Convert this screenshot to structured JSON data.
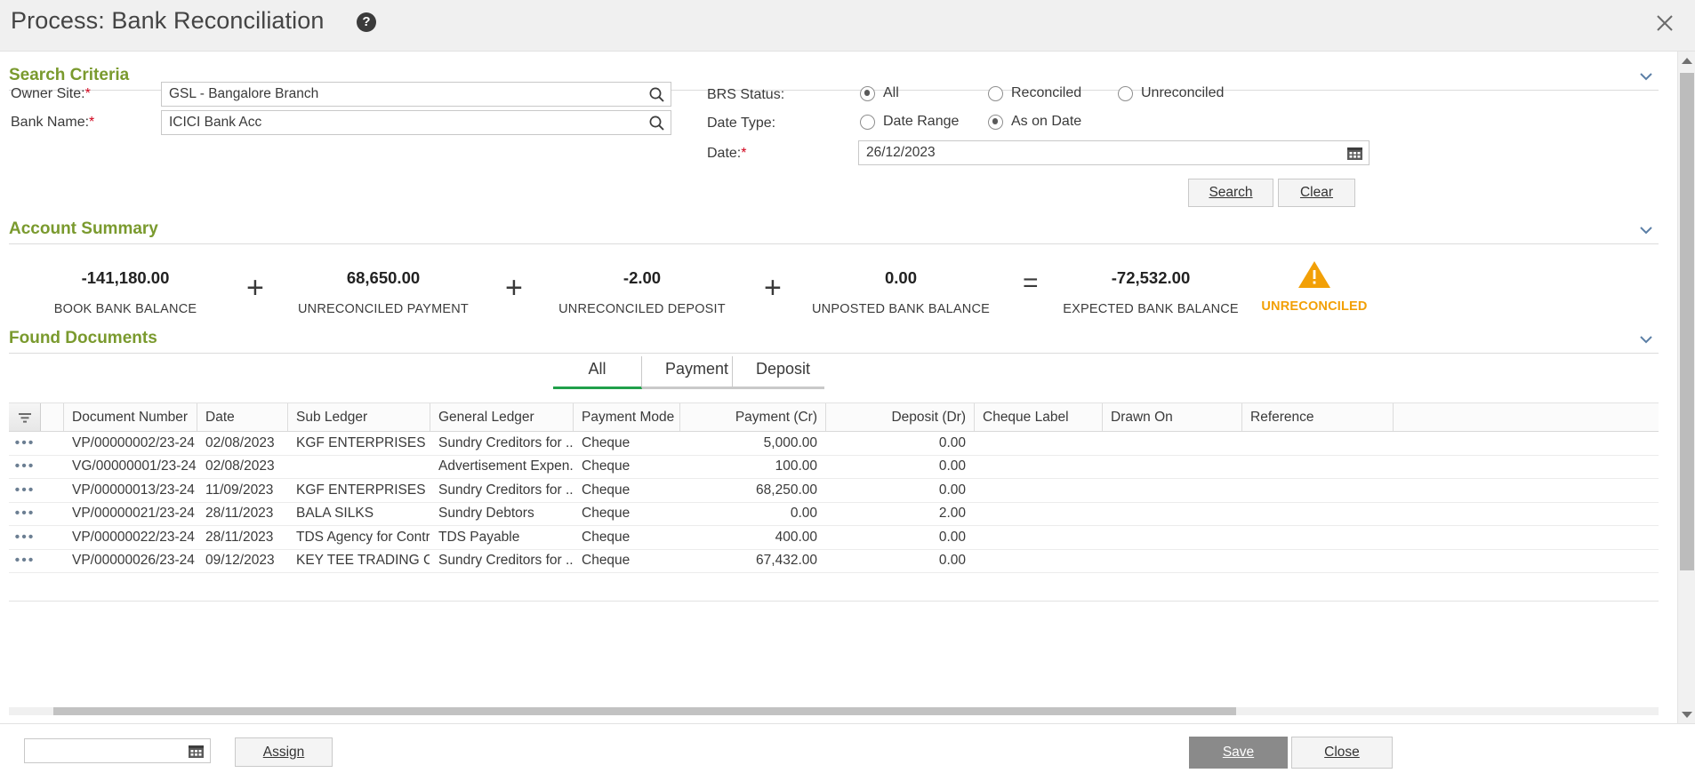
{
  "window": {
    "title": "Process: Bank Reconciliation",
    "help_icon": "help-icon",
    "close_icon": "close-icon"
  },
  "search_criteria": {
    "heading": "Search Criteria",
    "owner_site": {
      "label": "Owner Site:",
      "required": "*",
      "value": "GSL - Bangalore Branch",
      "placeholder": ""
    },
    "bank_name": {
      "label": "Bank Name:",
      "required": "*",
      "value": "ICICI Bank Acc",
      "placeholder": ""
    },
    "brs_status": {
      "label": "BRS Status:",
      "options": [
        "All",
        "Reconciled",
        "Unreconciled"
      ],
      "selected": "All"
    },
    "date_type": {
      "label": "Date Type:",
      "options": [
        "Date Range",
        "As on Date"
      ],
      "selected": "As on Date"
    },
    "date": {
      "label": "Date:",
      "required": "*",
      "value": "26/12/2023",
      "placeholder": ""
    },
    "search_button": "Search",
    "clear_button": "Clear"
  },
  "account_summary": {
    "heading": "Account Summary",
    "cells": [
      {
        "value": "-141,180.00",
        "label": "BOOK BANK BALANCE"
      },
      {
        "value": "68,650.00",
        "label": "UNRECONCILED PAYMENT"
      },
      {
        "value": "-2.00",
        "label": "UNRECONCILED DEPOSIT"
      },
      {
        "value": "0.00",
        "label": "UNPOSTED BANK BALANCE"
      },
      {
        "value": "-72,532.00",
        "label": "EXPECTED BANK BALANCE"
      }
    ],
    "operators": [
      "+",
      "+",
      "+",
      "="
    ],
    "status": {
      "label": "UNRECONCILED",
      "color": "#f2a007",
      "icon": "warning-triangle-icon"
    }
  },
  "found_documents": {
    "heading": "Found Documents",
    "tabs": [
      {
        "label": "All",
        "active": true
      },
      {
        "label": "Payment",
        "active": false
      },
      {
        "label": "Deposit",
        "active": false
      }
    ],
    "columns": [
      "Document Number",
      "Date",
      "Sub Ledger",
      "General Ledger",
      "Payment Mode",
      "Payment (Cr)",
      "Deposit (Dr)",
      "Cheque Label",
      "Drawn On",
      "Reference"
    ],
    "rows": [
      {
        "document_number": "VP/00000002/23-24",
        "date": "02/08/2023",
        "sub_ledger": "KGF ENTERPRISES",
        "general_ledger": "Sundry Creditors for ...",
        "payment_mode": "Cheque",
        "payment_cr": "5,000.00",
        "deposit_dr": "0.00",
        "cheque_label": "",
        "drawn_on": "",
        "reference": ""
      },
      {
        "document_number": "VG/00000001/23-24",
        "date": "02/08/2023",
        "sub_ledger": "",
        "general_ledger": "Advertisement Expen...",
        "payment_mode": "Cheque",
        "payment_cr": "100.00",
        "deposit_dr": "0.00",
        "cheque_label": "",
        "drawn_on": "",
        "reference": ""
      },
      {
        "document_number": "VP/00000013/23-24",
        "date": "11/09/2023",
        "sub_ledger": "KGF ENTERPRISES",
        "general_ledger": "Sundry Creditors for ...",
        "payment_mode": "Cheque",
        "payment_cr": "68,250.00",
        "deposit_dr": "0.00",
        "cheque_label": "",
        "drawn_on": "",
        "reference": ""
      },
      {
        "document_number": "VP/00000021/23-24",
        "date": "28/11/2023",
        "sub_ledger": "BALA SILKS",
        "general_ledger": "Sundry Debtors",
        "payment_mode": "Cheque",
        "payment_cr": "0.00",
        "deposit_dr": "2.00",
        "cheque_label": "",
        "drawn_on": "",
        "reference": ""
      },
      {
        "document_number": "VP/00000022/23-24",
        "date": "28/11/2023",
        "sub_ledger": "TDS Agency for Contr...",
        "general_ledger": "TDS Payable",
        "payment_mode": "Cheque",
        "payment_cr": "400.00",
        "deposit_dr": "0.00",
        "cheque_label": "",
        "drawn_on": "",
        "reference": ""
      },
      {
        "document_number": "VP/00000026/23-24",
        "date": "09/12/2023",
        "sub_ledger": "KEY TEE TRADING CO...",
        "general_ledger": "Sundry Creditors for ...",
        "payment_mode": "Cheque",
        "payment_cr": "67,432.00",
        "deposit_dr": "0.00",
        "cheque_label": "",
        "drawn_on": "",
        "reference": ""
      }
    ]
  },
  "footer": {
    "assign_date": {
      "value": "",
      "placeholder": "",
      "icon": "calendar-icon"
    },
    "assign_button": "Assign",
    "save_button": "Save",
    "close_button": "Close"
  },
  "colors": {
    "section_heading": "#7a9a2e",
    "tab_active": "#21a04a",
    "warning": "#f2a007",
    "required": "#d0021b"
  }
}
